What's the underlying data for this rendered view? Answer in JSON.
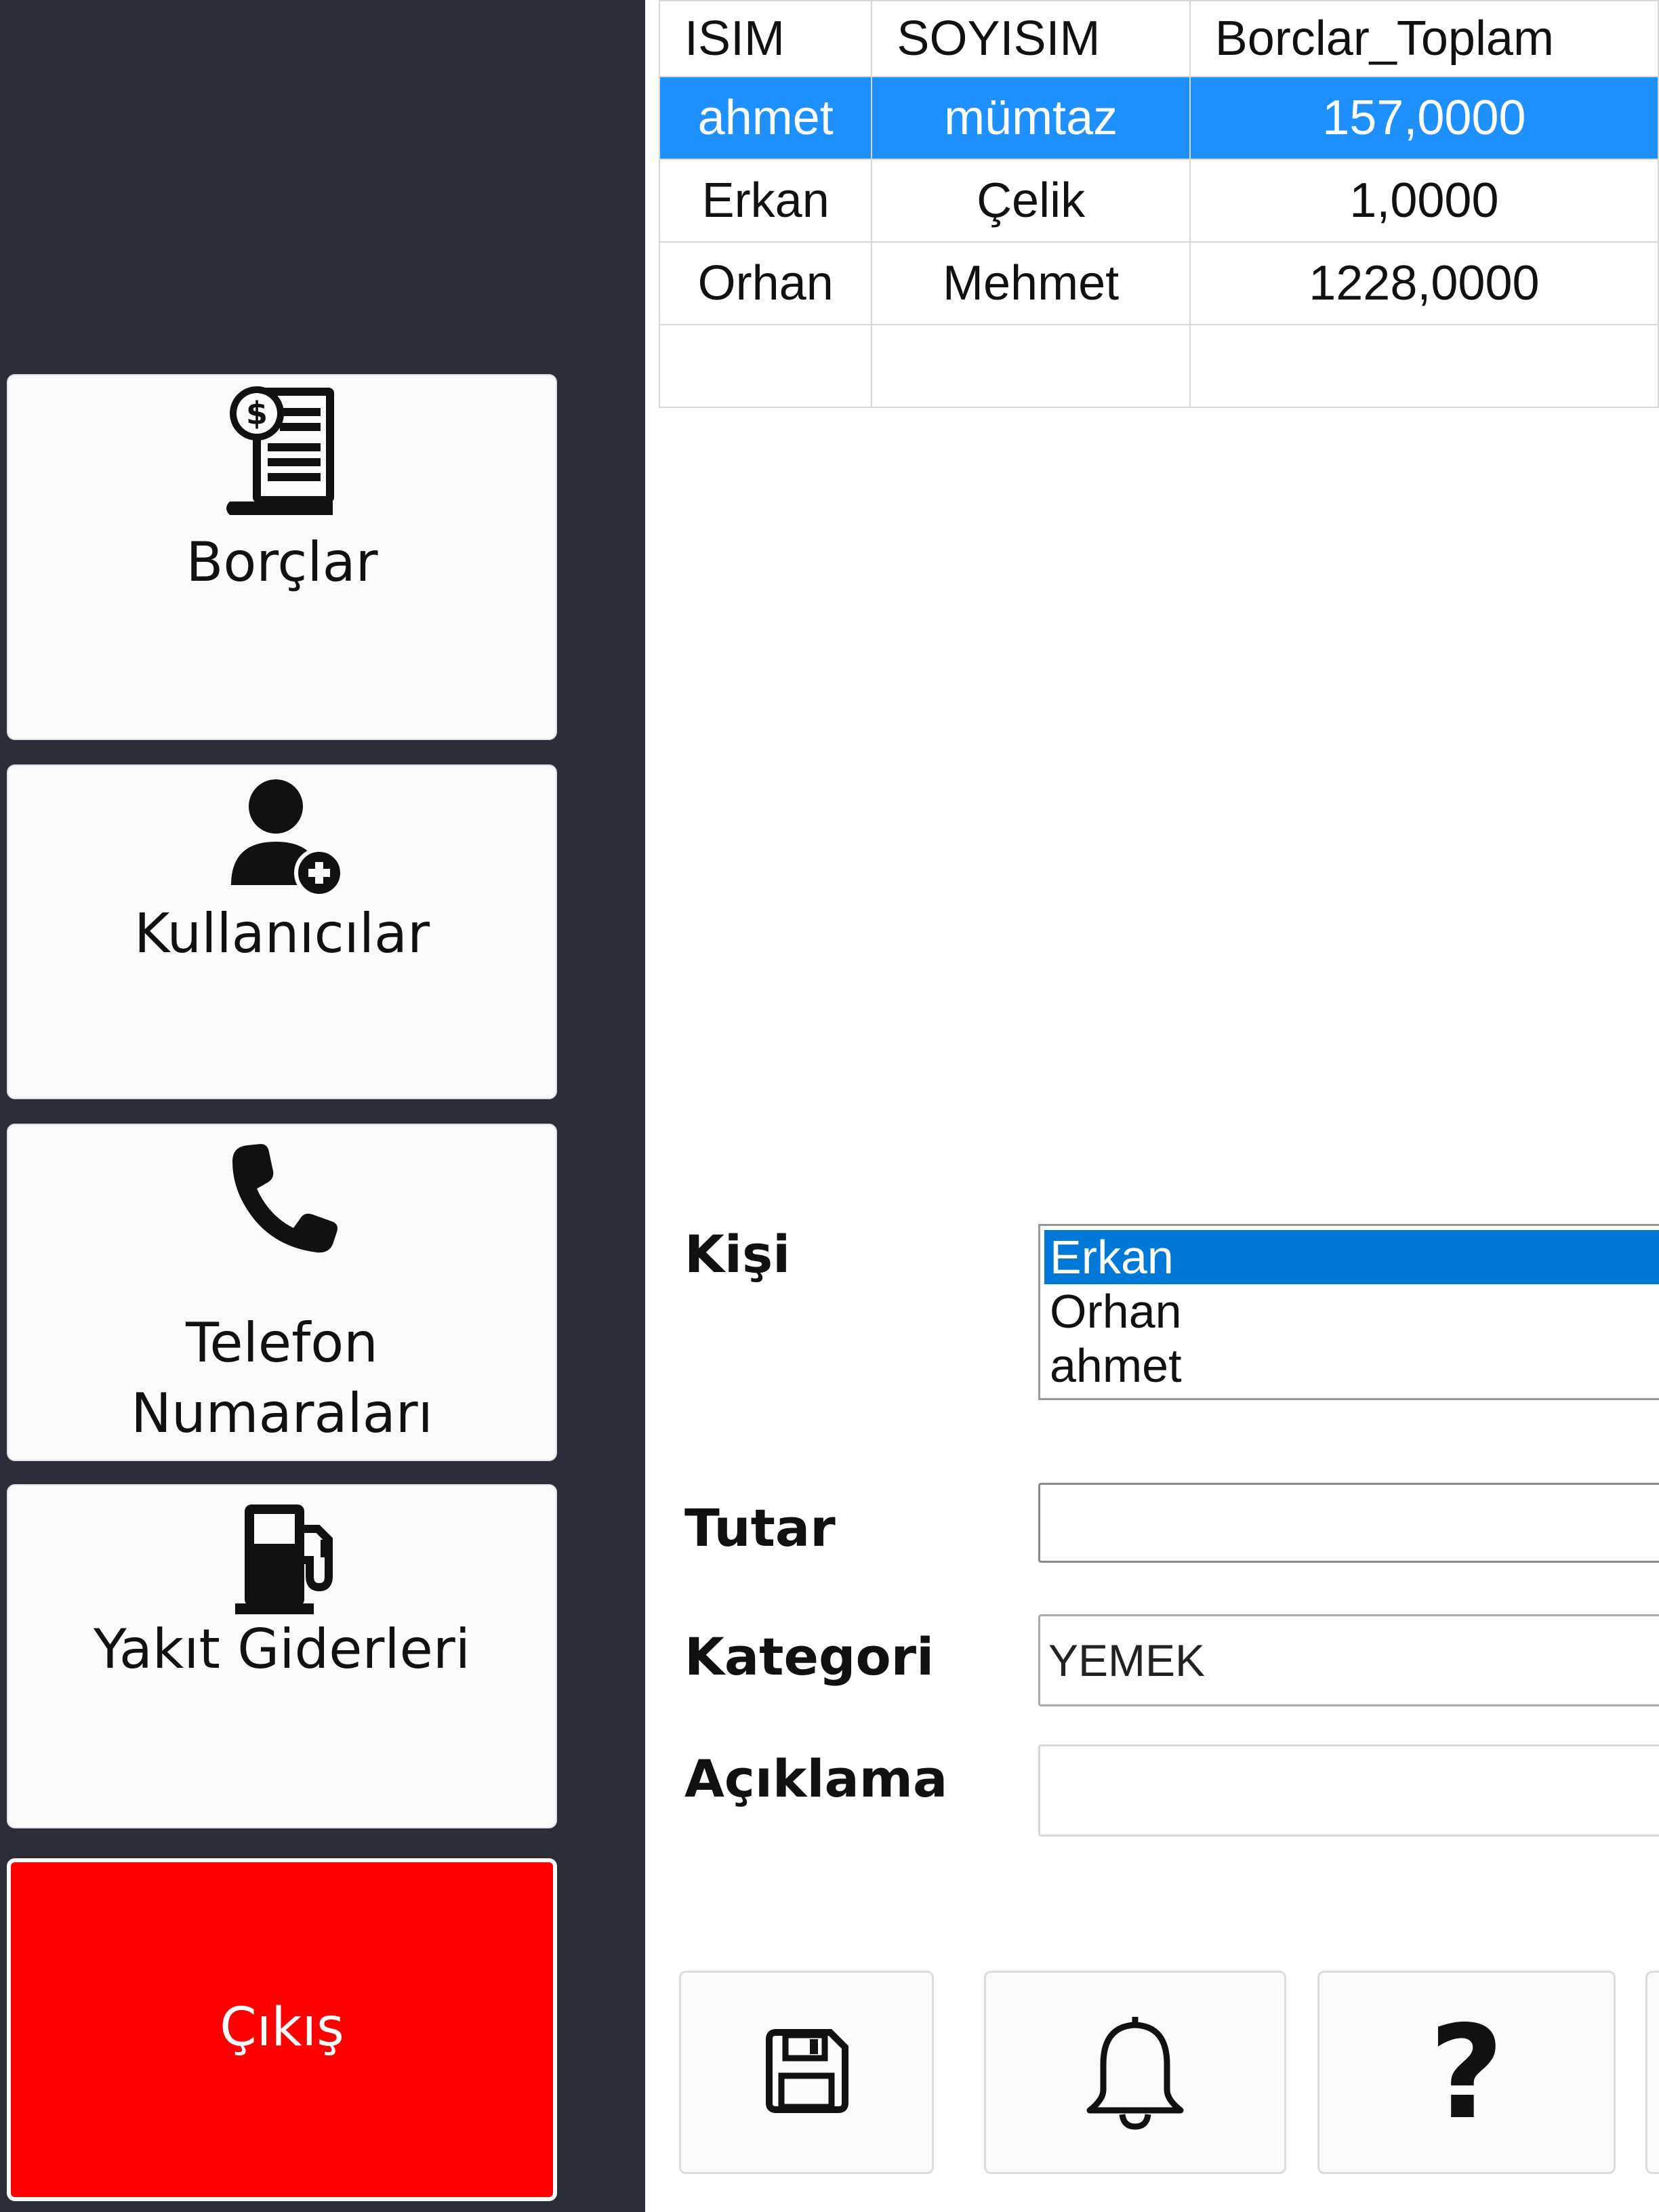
{
  "sidebar": {
    "items": [
      {
        "label": "Borçlar",
        "icon": "debt-invoice-icon"
      },
      {
        "label": "Kullanıcılar",
        "icon": "add-user-icon"
      },
      {
        "label": "Telefon\nNumaraları",
        "icon": "phone-icon"
      },
      {
        "label": "Yakıt Giderleri",
        "icon": "fuel-pump-icon"
      },
      {
        "label": "Çıkış",
        "icon": "",
        "color": "#ff0000"
      }
    ]
  },
  "table": {
    "columns": [
      "ISIM",
      "SOYISIM",
      "Borclar_Toplam"
    ],
    "rows": [
      [
        "ahmet",
        "mümtaz",
        "157,0000"
      ],
      [
        "Erkan",
        "Çelik",
        "1,0000"
      ],
      [
        "Orhan",
        "Mehmet",
        "1228,0000"
      ]
    ],
    "selected_row": 0,
    "selection_color": "#1e90ff"
  },
  "form": {
    "kisi_label": "Kişi",
    "kisi_options": [
      "Erkan",
      "Orhan",
      "ahmet"
    ],
    "kisi_selected": "Erkan",
    "tutar_label": "Tutar",
    "tutar_value": "",
    "kategori_label": "Kategori",
    "kategori_value": "YEMEK",
    "aciklama_label": "Açıklama",
    "aciklama_value": ""
  },
  "toolbar": {
    "buttons": [
      "save-icon",
      "bell-icon",
      "question-icon"
    ],
    "help_glyph": "?"
  },
  "colors": {
    "sidebar_bg": "#2b2d38",
    "exit_button": "#ff0000",
    "listbox_selected": "#0078d7"
  }
}
